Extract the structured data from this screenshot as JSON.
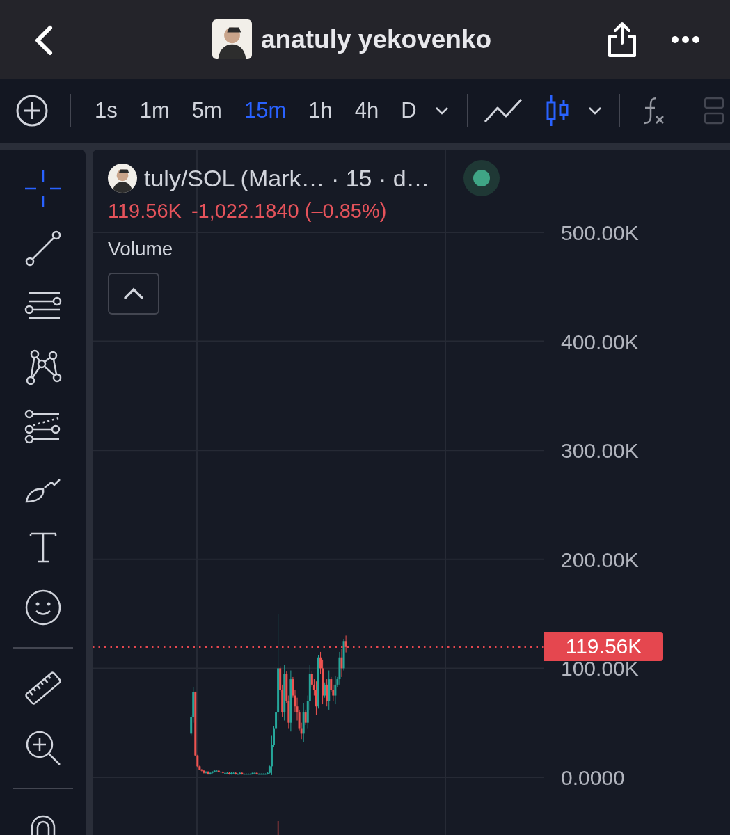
{
  "header": {
    "title": "anatuly yekovenko"
  },
  "toolbar": {
    "intervals": [
      {
        "label": "1s",
        "selected": false
      },
      {
        "label": "1m",
        "selected": false
      },
      {
        "label": "5m",
        "selected": false
      },
      {
        "label": "15m",
        "selected": true
      },
      {
        "label": "1h",
        "selected": false
      },
      {
        "label": "4h",
        "selected": false
      },
      {
        "label": "D",
        "selected": false
      }
    ],
    "chart_types": [
      {
        "kind": "line",
        "selected": false
      },
      {
        "kind": "candles",
        "selected": true
      }
    ]
  },
  "tool_groups": [
    {
      "tools": [
        {
          "kind": "crosshair",
          "selected": true
        },
        {
          "kind": "trend-line",
          "selected": false
        },
        {
          "kind": "parallel-lines",
          "selected": false
        },
        {
          "kind": "pattern",
          "selected": false
        },
        {
          "kind": "fib",
          "selected": false
        },
        {
          "kind": "brush",
          "selected": false
        },
        {
          "kind": "text",
          "selected": false
        },
        {
          "kind": "emoji",
          "selected": false
        }
      ]
    },
    {
      "tools": [
        {
          "kind": "ruler",
          "selected": false
        },
        {
          "kind": "zoom",
          "selected": false
        }
      ]
    },
    {
      "tools": [
        {
          "kind": "magnet",
          "selected": false
        }
      ]
    }
  ],
  "legend": {
    "symbol": "tuly/SOL (Mark… · 15 · d…",
    "live": true,
    "price": "119.56K",
    "change": "-1,022.1840 (–0.85%)",
    "indicator": "Volume"
  },
  "chart": {
    "last_price": "119.56K",
    "chart_data": {
      "type": "candlestick",
      "grid": true,
      "ylim": [
        -53,
        576
      ],
      "ref_lines": [
        {
          "axis": "y",
          "value": 119.56
        }
      ],
      "categories": [
        null,
        null,
        null,
        null,
        null,
        null,
        null,
        null,
        null,
        null,
        null,
        null,
        null,
        null,
        null,
        null,
        null,
        null,
        null,
        null,
        null,
        null,
        null,
        null,
        null,
        null,
        null,
        null,
        null,
        null,
        null,
        null,
        null,
        null,
        null,
        null,
        null,
        null,
        null,
        null,
        null,
        null,
        null,
        null,
        null,
        null,
        null,
        null,
        null,
        null,
        null,
        null,
        null,
        null,
        null,
        null,
        null,
        null,
        null,
        null,
        null,
        null,
        null,
        null,
        null,
        null,
        null,
        null,
        null,
        null,
        null,
        null,
        null,
        null,
        null,
        null,
        null,
        null,
        null,
        null,
        null,
        null,
        null,
        null,
        null,
        null,
        null,
        null,
        null,
        null,
        null,
        null,
        null,
        null,
        null,
        null,
        null,
        null,
        null,
        null,
        null,
        null,
        null,
        null,
        null,
        null,
        null,
        null,
        null,
        null,
        null,
        null,
        null,
        null,
        null,
        null,
        null,
        null,
        null,
        null,
        null,
        null,
        null,
        null,
        null,
        null,
        null,
        null,
        null,
        null,
        null,
        null,
        null,
        null,
        null,
        null,
        null,
        null,
        null,
        null,
        null,
        null,
        null,
        null,
        null,
        null,
        null,
        null,
        null,
        null,
        null,
        null,
        null,
        null,
        null,
        null,
        null,
        null,
        null,
        null,
        null,
        null,
        null,
        null,
        null,
        null,
        null,
        null,
        null,
        null,
        null,
        null,
        null,
        null,
        null,
        null,
        null,
        null,
        null,
        null,
        null,
        null,
        null,
        null,
        null,
        null,
        null,
        null,
        null,
        null,
        null,
        null,
        null,
        null,
        null,
        null,
        null,
        null,
        null,
        null,
        null,
        null,
        null,
        null,
        null,
        null,
        null,
        null,
        null,
        null,
        null,
        null,
        null
      ],
      "yticks": [
        {
          "value": 500,
          "label": "500.00K"
        },
        {
          "value": 400,
          "label": "400.00K"
        },
        {
          "value": 300,
          "label": "300.00K"
        },
        {
          "value": 200,
          "label": "200.00K"
        },
        {
          "value": 100,
          "label": "100.00K"
        },
        {
          "value": 0,
          "label": "0.0000"
        }
      ],
      "ohlc": [
        null,
        null,
        null,
        null,
        null,
        null,
        null,
        null,
        null,
        null,
        null,
        null,
        null,
        null,
        null,
        null,
        null,
        null,
        null,
        null,
        null,
        null,
        null,
        null,
        null,
        null,
        null,
        null,
        null,
        null,
        null,
        null,
        null,
        null,
        null,
        null,
        null,
        null,
        null,
        null,
        null,
        null,
        null,
        null,
        null,
        null,
        [
          40,
          57,
          38,
          55
        ],
        [
          55,
          83,
          50,
          78
        ],
        [
          78,
          78.6,
          19.4,
          20
        ],
        [
          20,
          20.6,
          9.4,
          10
        ],
        [
          10,
          10.6,
          6.4,
          7
        ],
        [
          7,
          7.6,
          5.4,
          6
        ],
        [
          6,
          6.6,
          3.4,
          4
        ],
        [
          4,
          5.6,
          3.4,
          5
        ],
        [
          5,
          5.6,
          2.4,
          3
        ],
        [
          3,
          4.6,
          2.4,
          4
        ],
        [
          4,
          5.6,
          3.4,
          5
        ],
        [
          5,
          6.6,
          4.4,
          6
        ],
        [
          6,
          6.6,
          5.4,
          6
        ],
        [
          6,
          6.6,
          4.4,
          5
        ],
        [
          5,
          5.6,
          4.4,
          5
        ],
        [
          5,
          5.6,
          3.4,
          4
        ],
        [
          4,
          4.6,
          3.4,
          4
        ],
        [
          4,
          4.6,
          3.4,
          4
        ],
        [
          4,
          4.6,
          2.4,
          3
        ],
        [
          3,
          4.6,
          2.4,
          4
        ],
        [
          4,
          4.6,
          3.4,
          4
        ],
        [
          4,
          4.6,
          2.4,
          3
        ],
        [
          3,
          3.6,
          2.4,
          3
        ],
        [
          3,
          4.6,
          2.4,
          4
        ],
        [
          4,
          4.6,
          2.4,
          3
        ],
        [
          3,
          3.6,
          2.4,
          3
        ],
        [
          3,
          3.6,
          2.4,
          3
        ],
        [
          3,
          3.6,
          2.4,
          3
        ],
        [
          3,
          3.6,
          2.4,
          3
        ],
        [
          3,
          4.6,
          2.4,
          4
        ],
        [
          4,
          4.6,
          3.4,
          4
        ],
        [
          4,
          4.6,
          2.4,
          3
        ],
        [
          3,
          3.6,
          2.4,
          3
        ],
        [
          3,
          3.6,
          2.4,
          3
        ],
        [
          3,
          3.6,
          2.4,
          3
        ],
        [
          3,
          3.6,
          2.4,
          3
        ],
        [
          3,
          4.6,
          2.4,
          4
        ],
        [
          4,
          10.6,
          3.4,
          10
        ],
        [
          10,
          38,
          2,
          30
        ],
        [
          30,
          47,
          28,
          45
        ],
        [
          45,
          65,
          40,
          60
        ],
        [
          60,
          150,
          52,
          100
        ],
        [
          100,
          102,
          78,
          80
        ],
        [
          80,
          85,
          55,
          60
        ],
        [
          60,
          103,
          52,
          95
        ],
        [
          95,
          97,
          68,
          70
        ],
        [
          70,
          75,
          45,
          50
        ],
        [
          50,
          98,
          42,
          90
        ],
        [
          90,
          92,
          73,
          75
        ],
        [
          75,
          80,
          60,
          65
        ],
        [
          65,
          73,
          52,
          60
        ],
        [
          60,
          62,
          43,
          45
        ],
        [
          45,
          50,
          35,
          40
        ],
        [
          40,
          68,
          32,
          60
        ],
        [
          60,
          62,
          48,
          50
        ],
        [
          50,
          75,
          45,
          70
        ],
        [
          70,
          103,
          62,
          95
        ],
        [
          95,
          97,
          83,
          85
        ],
        [
          85,
          90,
          75,
          80
        ],
        [
          80,
          88,
          57,
          65
        ],
        [
          65,
          112,
          63,
          110
        ],
        [
          110,
          115,
          95,
          100
        ],
        [
          100,
          108,
          67,
          75
        ],
        [
          75,
          87,
          73,
          85
        ],
        [
          85,
          90,
          65,
          70
        ],
        [
          70,
          98,
          62,
          90
        ],
        [
          90,
          92,
          78,
          80
        ],
        [
          80,
          85,
          70,
          75
        ],
        [
          75,
          93,
          67,
          85
        ],
        [
          85,
          92,
          83,
          90
        ],
        [
          90,
          115,
          85,
          110
        ],
        [
          110,
          118,
          92,
          100
        ],
        [
          100,
          127,
          98,
          125
        ],
        [
          125,
          130,
          114.56,
          119.56
        ],
        null,
        null,
        null,
        null,
        null,
        null,
        null,
        null,
        null,
        null,
        null,
        null,
        null,
        null,
        null,
        null,
        null,
        null,
        null,
        null,
        null,
        null,
        null,
        null,
        null,
        null,
        null,
        null,
        null,
        null,
        null,
        null,
        null,
        null,
        null,
        null,
        null,
        null,
        null,
        null,
        null,
        null,
        null,
        null,
        null,
        null,
        null,
        null,
        null,
        null,
        null,
        null,
        null,
        null,
        null,
        null,
        null,
        null,
        null,
        null,
        null,
        null,
        null,
        null,
        null,
        null,
        null,
        null,
        null,
        null,
        null,
        null,
        null,
        null,
        null,
        null,
        null,
        null,
        null,
        null,
        null,
        null,
        null,
        null,
        null,
        null,
        null,
        null,
        null,
        null,
        null,
        null,
        null
      ]
    }
  }
}
